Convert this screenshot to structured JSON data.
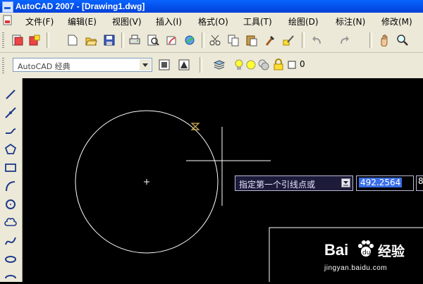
{
  "window": {
    "title": "AutoCAD 2007 - [Drawing1.dwg]"
  },
  "menu": {
    "items": [
      "文件(F)",
      "编辑(E)",
      "视图(V)",
      "插入(I)",
      "格式(O)",
      "工具(T)",
      "绘图(D)",
      "标注(N)",
      "修改(M)"
    ]
  },
  "workspace": {
    "value": "AutoCAD 经典"
  },
  "layer": {
    "name": "0"
  },
  "dynamic_input": {
    "prompt": "指定第一个引线点或",
    "x_value": "492.2564",
    "y_value_partial": "8"
  },
  "watermark": {
    "brand": "Bai",
    "brand_suffix": "经验",
    "url": "jingyan.baidu.com"
  },
  "colors": {
    "canvas_background": "#000000",
    "entity": "#ffffff",
    "chrome": "#ece9d8",
    "titlebar": "#0a5cf0",
    "input_highlight": "#3a6ee8"
  },
  "icons": {
    "toolbar1": [
      "new-sheetset-icon",
      "open-sheetset-icon",
      "new-icon",
      "open-icon",
      "save-icon",
      "plot-icon",
      "plot-preview-icon",
      "publish-icon",
      "3d-dwf-icon",
      "cut-icon",
      "copy-icon",
      "paste-icon",
      "match-properties-icon",
      "block-editor-icon",
      "undo-icon",
      "redo-icon",
      "pan-icon",
      "zoom-realtime-icon"
    ],
    "toolbar2": [
      "workspace-settings-icon",
      "save-workspace-icon",
      "layer-manager-icon",
      "bulb-icon",
      "sun-icon",
      "freeze-icon",
      "lock-icon",
      "color-square-icon"
    ],
    "draw_toolbar": [
      "line-icon",
      "construction-line-icon",
      "polyline-icon",
      "polygon-icon",
      "rectangle-icon",
      "arc-icon",
      "circle-icon",
      "revision-cloud-icon",
      "spline-icon",
      "ellipse-icon"
    ]
  }
}
